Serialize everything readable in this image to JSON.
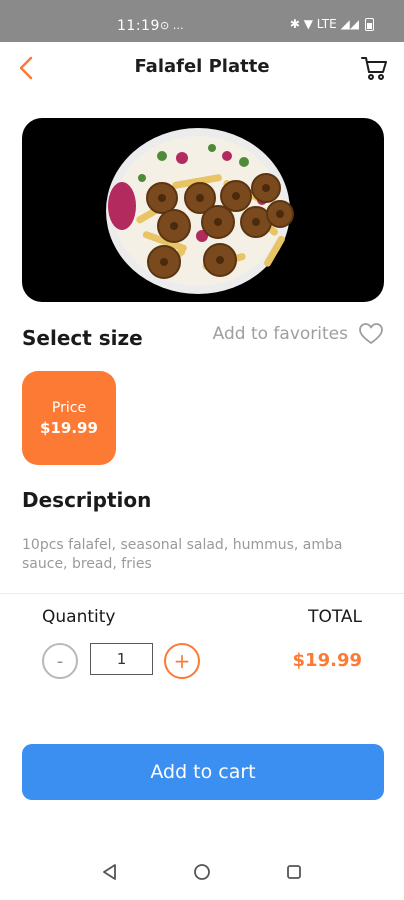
{
  "status_bar": {
    "time": "11:19",
    "left_icons": "⊙ …",
    "right_icons": "✱ ▼ LTE ◢◢"
  },
  "header": {
    "title": "Falafel Platte"
  },
  "sections": {
    "select_size": "Select size",
    "favorites": "Add to favorites",
    "description_title": "Description",
    "description_text": "10pcs falafel, seasonal salad, hummus, amba sauce, bread, fries"
  },
  "size_option": {
    "label": "Price",
    "price": "$19.99"
  },
  "order": {
    "quantity_label": "Quantity",
    "quantity_value": "1",
    "minus": "-",
    "plus": "+",
    "total_label": "TOTAL",
    "total_value": "$19.99"
  },
  "cta": {
    "label": "Add to cart"
  },
  "colors": {
    "accent": "#fd7a35",
    "primary": "#3a8ff0",
    "muted": "#9a9a9a"
  }
}
